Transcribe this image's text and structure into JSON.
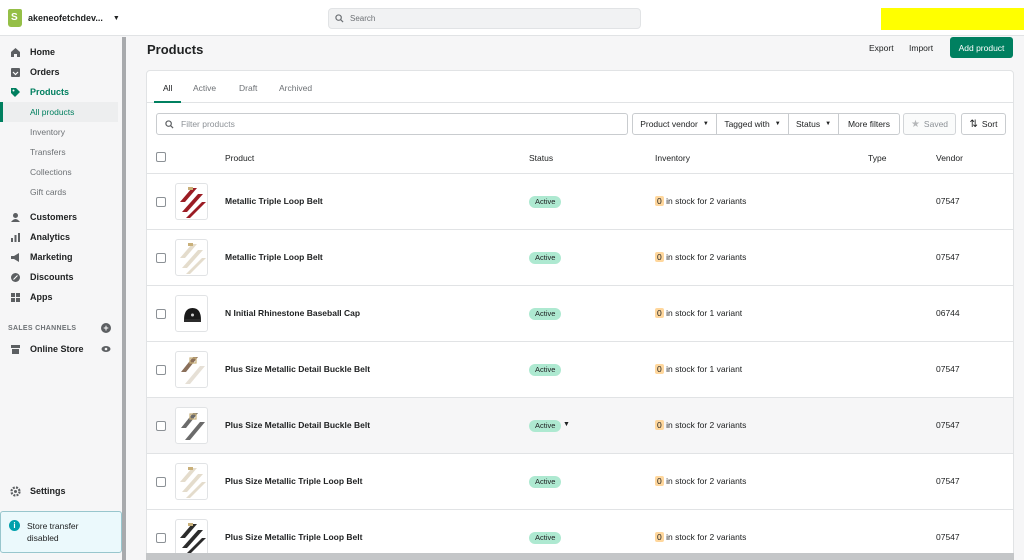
{
  "topbar": {
    "store_name": "akeneofetchdev...",
    "search_placeholder": "Search",
    "highlight_color": "#ffff00"
  },
  "sidebar": {
    "items": [
      {
        "label": "Home",
        "icon": "home-icon"
      },
      {
        "label": "Orders",
        "icon": "orders-icon"
      },
      {
        "label": "Products",
        "icon": "tag-icon"
      }
    ],
    "subitems": [
      "All products",
      "Inventory",
      "Transfers",
      "Collections",
      "Gift cards"
    ],
    "items2": [
      {
        "label": "Customers",
        "icon": "customers-icon"
      },
      {
        "label": "Analytics",
        "icon": "analytics-icon"
      },
      {
        "label": "Marketing",
        "icon": "marketing-icon"
      },
      {
        "label": "Discounts",
        "icon": "discounts-icon"
      },
      {
        "label": "Apps",
        "icon": "apps-icon"
      }
    ],
    "sales_channels_label": "SALES CHANNELS",
    "online_store": "Online Store",
    "settings": "Settings",
    "notice": "Store transfer disabled"
  },
  "header": {
    "title": "Products",
    "export": "Export",
    "import": "Import",
    "add": "Add product"
  },
  "tabs": [
    "All",
    "Active",
    "Draft",
    "Archived"
  ],
  "filters": {
    "placeholder": "Filter products",
    "vendor": "Product vendor",
    "tagged": "Tagged with",
    "status": "Status",
    "more": "More filters",
    "saved": "Saved",
    "sort": "Sort"
  },
  "columns": [
    "Product",
    "Status",
    "Inventory",
    "Type",
    "Vendor"
  ],
  "rows": [
    {
      "name": "Metallic Triple Loop Belt",
      "status": "Active",
      "inv_num": "0",
      "inv_text": " in stock for 2 variants",
      "vendor": "07547"
    },
    {
      "name": "Metallic Triple Loop Belt",
      "status": "Active",
      "inv_num": "0",
      "inv_text": " in stock for 2 variants",
      "vendor": "07547"
    },
    {
      "name": "N Initial Rhinestone Baseball Cap",
      "status": "Active",
      "inv_num": "0",
      "inv_text": " in stock for 1 variant",
      "vendor": "06744"
    },
    {
      "name": "Plus Size Metallic Detail Buckle Belt",
      "status": "Active",
      "inv_num": "0",
      "inv_text": " in stock for 1 variant",
      "vendor": "07547"
    },
    {
      "name": "Plus Size Metallic Detail Buckle Belt",
      "status": "Active",
      "inv_num": "0",
      "inv_text": " in stock for 2 variants",
      "vendor": "07547"
    },
    {
      "name": "Plus Size Metallic Triple Loop Belt",
      "status": "Active",
      "inv_num": "0",
      "inv_text": " in stock for 2 variants",
      "vendor": "07547"
    },
    {
      "name": "Plus Size Metallic Triple Loop Belt",
      "status": "Active",
      "inv_num": "0",
      "inv_text": " in stock for 2 variants",
      "vendor": "07547"
    }
  ],
  "colors": {
    "accent": "#008060",
    "badge_active": "#aee9d1",
    "inventory_warning": "#ffd79d"
  }
}
